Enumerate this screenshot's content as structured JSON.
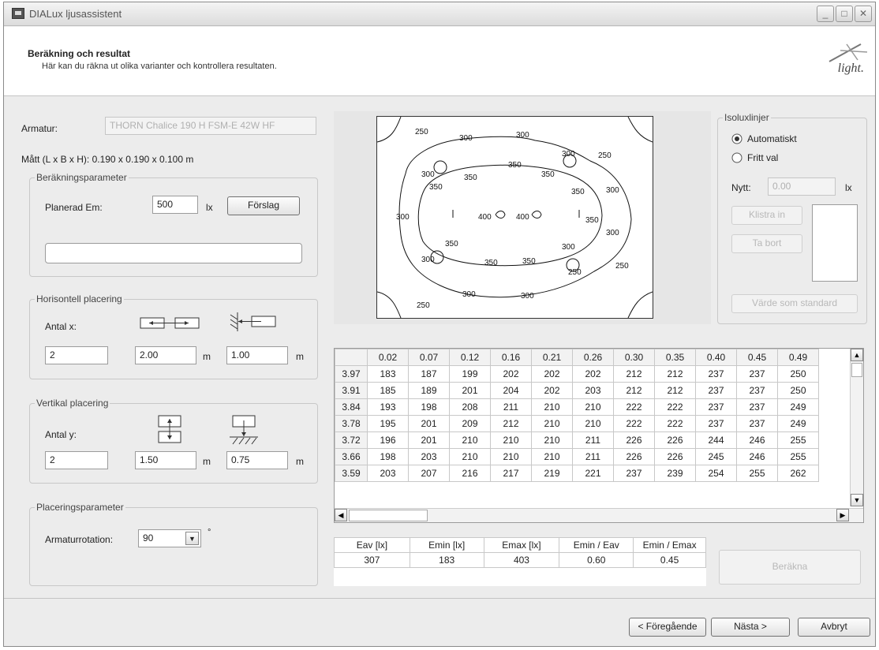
{
  "window": {
    "title": "DIALux ljusassistent",
    "controls": [
      "_",
      "□",
      "✕"
    ]
  },
  "header": {
    "title": "Beräkning och resultat",
    "subtitle": "Här kan du räkna ut olika varianter och kontrollera resultaten.",
    "logo_text": "light."
  },
  "luminaire": {
    "label": "Armatur:",
    "value": "THORN Chalice 190 H FSM-E 42W HF",
    "dimensions": "Mått (L x B x H): 0.190 x 0.190 x 0.100 m"
  },
  "calc_params": {
    "group_title": "Beräkningsparameter",
    "em_label": "Planerad Em:",
    "em_value": "500",
    "em_unit": "lx",
    "suggest_button": "Förslag",
    "result_field": ""
  },
  "horizontal": {
    "group_title": "Horisontell placering",
    "count_label": "Antal x:",
    "count": "2",
    "spacing": "2.00",
    "spacing_unit": "m",
    "wall": "1.00",
    "wall_unit": "m"
  },
  "vertical": {
    "group_title": "Vertikal placering",
    "count_label": "Antal y:",
    "count": "2",
    "spacing": "1.50",
    "spacing_unit": "m",
    "wall": "0.75",
    "wall_unit": "m"
  },
  "placement": {
    "group_title": "Placeringsparameter",
    "rotation_label": "Armaturrotation:",
    "rotation_value": "90",
    "rotation_unit": "°"
  },
  "isolux": {
    "group_title": "Isoluxlinjer",
    "option_auto": "Automatiskt",
    "option_free": "Fritt val",
    "selected": "Automatiskt",
    "new_label": "Nytt:",
    "new_value": "0.00",
    "new_unit": "lx",
    "paste_button": "Klistra in",
    "remove_button": "Ta bort",
    "default_button": "Värde som standard"
  },
  "isolux_plot": {
    "labels": [
      "250",
      "300",
      "300",
      "300",
      "250",
      "300",
      "350",
      "350",
      "350",
      "350",
      "300",
      "300",
      "350",
      "400",
      "400",
      "350",
      "300",
      "300",
      "350",
      "350",
      "350",
      "300",
      "250",
      "300",
      "300",
      "250",
      "250"
    ]
  },
  "grid": {
    "columns": [
      "0.02",
      "0.07",
      "0.12",
      "0.16",
      "0.21",
      "0.26",
      "0.30",
      "0.35",
      "0.40",
      "0.45",
      "0.49"
    ],
    "rows": [
      {
        "y": "3.97",
        "values": [
          "183",
          "187",
          "199",
          "202",
          "202",
          "202",
          "212",
          "212",
          "237",
          "237",
          "250"
        ]
      },
      {
        "y": "3.91",
        "values": [
          "185",
          "189",
          "201",
          "204",
          "202",
          "203",
          "212",
          "212",
          "237",
          "237",
          "250"
        ]
      },
      {
        "y": "3.84",
        "values": [
          "193",
          "198",
          "208",
          "211",
          "210",
          "210",
          "222",
          "222",
          "237",
          "237",
          "249"
        ]
      },
      {
        "y": "3.78",
        "values": [
          "195",
          "201",
          "209",
          "212",
          "210",
          "210",
          "222",
          "222",
          "237",
          "237",
          "249"
        ]
      },
      {
        "y": "3.72",
        "values": [
          "196",
          "201",
          "210",
          "210",
          "210",
          "211",
          "226",
          "226",
          "244",
          "246",
          "255"
        ]
      },
      {
        "y": "3.66",
        "values": [
          "198",
          "203",
          "210",
          "210",
          "210",
          "211",
          "226",
          "226",
          "245",
          "246",
          "255"
        ]
      },
      {
        "y": "3.59",
        "values": [
          "203",
          "207",
          "216",
          "217",
          "219",
          "221",
          "237",
          "239",
          "254",
          "255",
          "262"
        ]
      }
    ]
  },
  "results": {
    "headers": [
      "Eav [lx]",
      "Emin [lx]",
      "Emax [lx]",
      "Emin / Eav",
      "Emin / Emax"
    ],
    "values": [
      "307",
      "183",
      "403",
      "0.60",
      "0.45"
    ],
    "calculate_button": "Beräkna"
  },
  "footer": {
    "prev_button": "< Föregående",
    "next_button": "Nästa >",
    "cancel_button": "Avbryt"
  }
}
